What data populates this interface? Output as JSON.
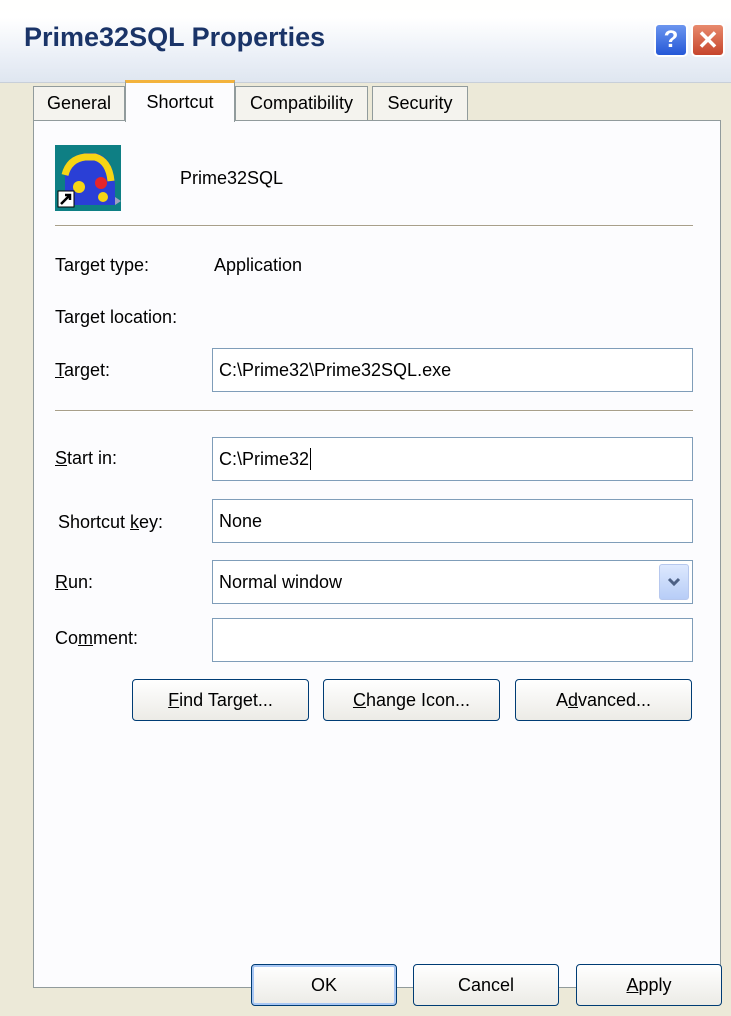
{
  "window": {
    "title": "Prime32SQL Properties",
    "help_label": "?",
    "close_label": "✕"
  },
  "tabs": [
    {
      "label": "General",
      "active": false
    },
    {
      "label": "Shortcut",
      "active": true
    },
    {
      "label": "Compatibility",
      "active": false
    },
    {
      "label": "Security",
      "active": false
    }
  ],
  "shortcut": {
    "name": "Prime32SQL",
    "icon": "application-shortcut-icon",
    "target_type_label": "Target type:",
    "target_type_value": "Application",
    "target_location_label": "Target location:",
    "target_location_value": "",
    "target_label": {
      "pre": "",
      "key": "T",
      "post": "arget:"
    },
    "target_value": "C:\\Prime32\\Prime32SQL.exe",
    "start_in_label": {
      "pre": "",
      "key": "S",
      "post": "tart in:"
    },
    "start_in_value": "C:\\Prime32",
    "shortcut_key_label": {
      "pre": "Shortcut ",
      "key": "k",
      "post": "ey:"
    },
    "shortcut_key_value": "None",
    "run_label": {
      "pre": "",
      "key": "R",
      "post": "un:"
    },
    "run_value": "Normal window",
    "comment_label": {
      "pre": "Co",
      "key": "m",
      "post": "ment:"
    },
    "comment_value": "",
    "find_target": {
      "pre": "",
      "key": "F",
      "post": "ind Target..."
    },
    "change_icon": {
      "pre": "",
      "key": "C",
      "post": "hange Icon..."
    },
    "advanced": {
      "pre": "A",
      "key": "d",
      "post": "vanced..."
    }
  },
  "footer": {
    "ok_label": "OK",
    "cancel_label": "Cancel",
    "apply": {
      "pre": "",
      "key": "A",
      "post": "pply"
    }
  },
  "colors": {
    "face": "#ece9d8",
    "panel": "#fcfcfe",
    "title_text": "#1a3468",
    "tab_highlight": "#f3b33d"
  }
}
